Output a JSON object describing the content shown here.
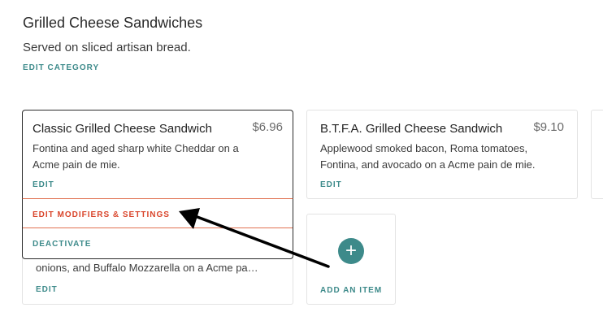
{
  "category": {
    "title": "Grilled Cheese Sandwiches",
    "description": "Served on sliced artisan bread.",
    "edit_label": "EDIT CATEGORY"
  },
  "items": [
    {
      "name": "Classic Grilled Cheese Sandwich",
      "price": "$6.96",
      "description_line1": "Fontina and aged sharp white Cheddar on a",
      "description_line2": "Acme pain de mie.",
      "edit_label": "EDIT"
    },
    {
      "name": "B.T.F.A. Grilled Cheese Sandwich",
      "price": "$9.10",
      "description_line1": "Applewood smoked bacon, Roma tomatoes,",
      "description_line2": "Fontina, and avocado on a Acme pain de mie.",
      "edit_label": "EDIT"
    },
    {
      "description_line2": "onions, and Buffalo Mozzarella on a Acme pa…",
      "edit_label": "EDIT"
    }
  ],
  "dropdown_menu": {
    "modifiers_label": "EDIT MODIFIERS & SETTINGS",
    "deactivate_label": "DEACTIVATE"
  },
  "add_item": {
    "icon_glyph": "+",
    "label": "ADD AN ITEM"
  },
  "colors": {
    "accent_teal": "#3d8a8a",
    "highlight_red": "#d9452b",
    "arrow": "#000000"
  }
}
